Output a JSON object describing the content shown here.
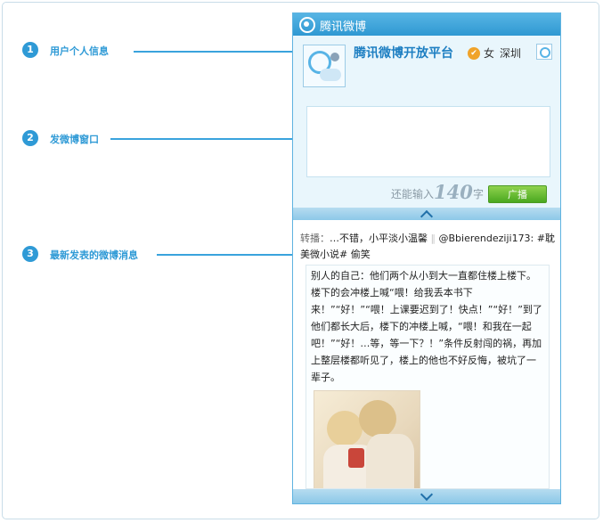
{
  "callouts": [
    {
      "num": "1",
      "label": "用户个人信息"
    },
    {
      "num": "2",
      "label": "发微博窗口"
    },
    {
      "num": "3",
      "label": "最新发表的微博消息"
    }
  ],
  "widget": {
    "title": "腾讯微博",
    "profile": {
      "name": "腾讯微博开放平台",
      "verified_icon": "verified-badge-icon",
      "gender": "女",
      "city": "深圳"
    },
    "compose": {
      "value": "",
      "remain_prefix": "还能输入",
      "remain_count": "140",
      "remain_unit": "字",
      "submit_label": "广播"
    },
    "feed": {
      "repost_label": "转播：",
      "repost_text": "…不错，小平淡小温馨",
      "separator": "‖",
      "mention": "@Bbierendeziji173:",
      "topic": "#耽美微小说#",
      "tail": "偷笑",
      "original_text": "别人的自己：他们两个从小到大一直都住楼上楼下。楼下的会冲楼上喊“喂！给我丢本书下来！”“好！”“喂！上课要迟到了！快点！”“好！”到了他们都长大后，楼下的冲楼上喊，“喂！和我在一起吧！”“好！…等，等一下？！”条件反射闯的祸，再加上整层楼都听见了，楼上的他也不好反悔，被坑了一辈子。"
    },
    "colors": {
      "accent": "#2f9ad6",
      "header": "#3aa3dd",
      "button": "#5ab52a"
    }
  }
}
